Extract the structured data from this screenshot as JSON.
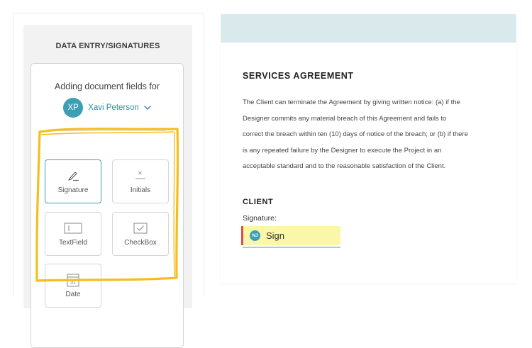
{
  "sidebar": {
    "title": "DATA ENTRY/SIGNATURES",
    "adding_text": "Adding document fields for",
    "signer": {
      "initials": "XP",
      "name": "Xavi Peterson"
    },
    "fields": [
      {
        "label": "Signature",
        "icon": "pen-icon",
        "selected": true
      },
      {
        "label": "Initials",
        "icon": "initials-icon",
        "selected": false
      },
      {
        "label": "TextField",
        "icon": "textfield-icon",
        "selected": false
      },
      {
        "label": "CheckBox",
        "icon": "checkbox-icon",
        "selected": false
      },
      {
        "label": "Date",
        "icon": "calendar-icon",
        "selected": false,
        "day": "31"
      }
    ]
  },
  "document": {
    "title": "SERVICES AGREEMENT",
    "paragraph_lines": [
      "The Client can terminate the Agreement by giving written notice: (a) if the",
      "Designer commits any material breach of this Agreement and fails to",
      "correct the breach within ten (10) days of notice of the breach; or (b) if there",
      "is any repeated failure by the Designer to execute the Project in an",
      "acceptable standard and to the reasonable satisfaction of the Client."
    ],
    "client_heading": "CLIENT",
    "signature_label": "Signature:",
    "sign_field": {
      "initials": "NJ",
      "label": "Sign"
    }
  },
  "colors": {
    "accent": "#3d9fb4",
    "highlight": "#f5bd1f",
    "sign_field": "#fbf7a8",
    "required": "#e24b4b"
  }
}
